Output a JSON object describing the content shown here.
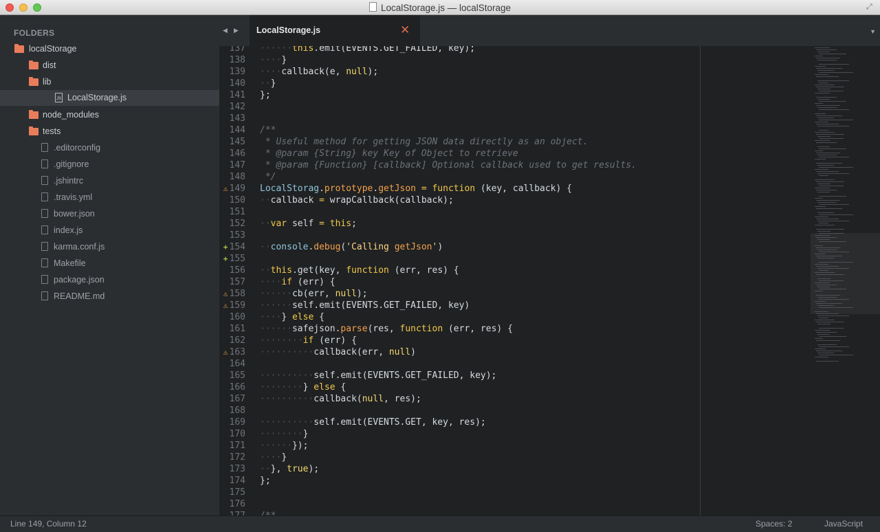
{
  "window": {
    "title": "LocalStorage.js — localStorage"
  },
  "sidebar": {
    "header": "FOLDERS",
    "items": [
      {
        "label": "localStorage",
        "kind": "folder",
        "depth": 0
      },
      {
        "label": "dist",
        "kind": "folder",
        "depth": 1
      },
      {
        "label": "lib",
        "kind": "folder",
        "depth": 1
      },
      {
        "label": "LocalStorage.js",
        "kind": "js-file",
        "depth": 2,
        "selected": true
      },
      {
        "label": "node_modules",
        "kind": "folder",
        "depth": 1
      },
      {
        "label": "tests",
        "kind": "folder",
        "depth": 1
      },
      {
        "label": ".editorconfig",
        "kind": "file",
        "depth": 2
      },
      {
        "label": ".gitignore",
        "kind": "file",
        "depth": 2
      },
      {
        "label": ".jshintrc",
        "kind": "file",
        "depth": 2
      },
      {
        "label": ".travis.yml",
        "kind": "file",
        "depth": 2
      },
      {
        "label": "bower.json",
        "kind": "file",
        "depth": 2
      },
      {
        "label": "index.js",
        "kind": "file",
        "depth": 2
      },
      {
        "label": "karma.conf.js",
        "kind": "file",
        "depth": 2
      },
      {
        "label": "Makefile",
        "kind": "file",
        "depth": 2
      },
      {
        "label": "package.json",
        "kind": "file",
        "depth": 2
      },
      {
        "label": "README.md",
        "kind": "file",
        "depth": 2
      }
    ]
  },
  "tabs": [
    {
      "label": "LocalStorage.js",
      "active": true
    }
  ],
  "editor": {
    "lines": [
      {
        "n": "137",
        "mark": "",
        "text": "······this.emit(EVENTS.GET_FAILED, key);"
      },
      {
        "n": "138",
        "mark": "",
        "text": "····}"
      },
      {
        "n": "139",
        "mark": "",
        "text": "····callback(e, null);"
      },
      {
        "n": "140",
        "mark": "",
        "text": "··}"
      },
      {
        "n": "141",
        "mark": "",
        "text": "};"
      },
      {
        "n": "142",
        "mark": "",
        "text": ""
      },
      {
        "n": "143",
        "mark": "",
        "text": ""
      },
      {
        "n": "144",
        "mark": "",
        "text": "/**"
      },
      {
        "n": "145",
        "mark": "",
        "text": " * Useful method for getting JSON data directly as an object."
      },
      {
        "n": "146",
        "mark": "",
        "text": " * @param {String} key Key of Object to retrieve"
      },
      {
        "n": "147",
        "mark": "",
        "text": " * @param {Function} [callback] Optional callback used to get results."
      },
      {
        "n": "148",
        "mark": "",
        "text": " */"
      },
      {
        "n": "149",
        "mark": "warn",
        "text": "LocalStorag.prototype.getJson = function (key, callback) {"
      },
      {
        "n": "150",
        "mark": "",
        "text": "··callback = wrapCallback(callback);"
      },
      {
        "n": "151",
        "mark": "",
        "text": ""
      },
      {
        "n": "152",
        "mark": "",
        "text": "··var self = this;"
      },
      {
        "n": "153",
        "mark": "",
        "text": ""
      },
      {
        "n": "154",
        "mark": "add",
        "text": "··console.debug('Calling getJson')"
      },
      {
        "n": "155",
        "mark": "add",
        "text": ""
      },
      {
        "n": "156",
        "mark": "",
        "text": "··this.get(key, function (err, res) {"
      },
      {
        "n": "157",
        "mark": "",
        "text": "····if (err) {"
      },
      {
        "n": "158",
        "mark": "warn",
        "text": "······cb(err, null);"
      },
      {
        "n": "159",
        "mark": "warn",
        "text": "······self.emit(EVENTS.GET_FAILED, key)"
      },
      {
        "n": "160",
        "mark": "",
        "text": "····} else {"
      },
      {
        "n": "161",
        "mark": "",
        "text": "······safejson.parse(res, function (err, res) {"
      },
      {
        "n": "162",
        "mark": "",
        "text": "········if (err) {"
      },
      {
        "n": "163",
        "mark": "warn",
        "text": "··········callback(err, null)"
      },
      {
        "n": "164",
        "mark": "",
        "text": ""
      },
      {
        "n": "165",
        "mark": "",
        "text": "··········self.emit(EVENTS.GET_FAILED, key);"
      },
      {
        "n": "166",
        "mark": "",
        "text": "········} else {"
      },
      {
        "n": "167",
        "mark": "",
        "text": "··········callback(null, res);"
      },
      {
        "n": "168",
        "mark": "",
        "text": ""
      },
      {
        "n": "169",
        "mark": "",
        "text": "··········self.emit(EVENTS.GET, key, res);"
      },
      {
        "n": "170",
        "mark": "",
        "text": "········}"
      },
      {
        "n": "171",
        "mark": "",
        "text": "······});"
      },
      {
        "n": "172",
        "mark": "",
        "text": "····}"
      },
      {
        "n": "173",
        "mark": "",
        "text": "··}, true);"
      },
      {
        "n": "174",
        "mark": "",
        "text": "};"
      },
      {
        "n": "175",
        "mark": "",
        "text": ""
      },
      {
        "n": "176",
        "mark": "",
        "text": ""
      },
      {
        "n": "177",
        "mark": "",
        "text": "/**"
      }
    ]
  },
  "status": {
    "position": "Line 149, Column 12",
    "spaces": "Spaces: 2",
    "syntax": "JavaScript"
  },
  "icons": {
    "warning": "warning-icon",
    "added": "plus-icon",
    "folder": "folder-icon",
    "file": "file-icon"
  },
  "colors": {
    "accent": "#e97d5b",
    "warning": "#e0a43a",
    "added": "#a6c94a"
  }
}
